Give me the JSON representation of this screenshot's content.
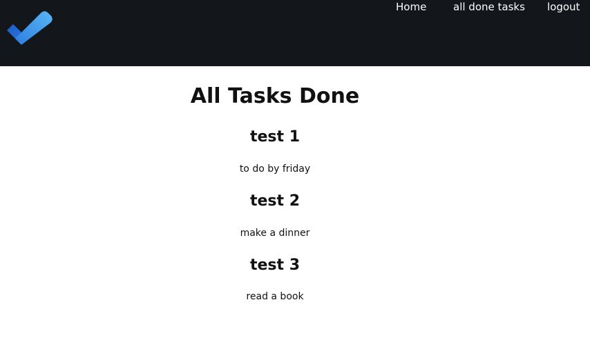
{
  "navbar": {
    "logo_icon": "checkmark-logo-icon",
    "accent_colors": [
      "#1f5fcf",
      "#4aa8f0"
    ],
    "background": "#13171b",
    "links": [
      {
        "label": "Home"
      },
      {
        "label": "all done tasks"
      },
      {
        "label": "logout"
      }
    ]
  },
  "main": {
    "title": "All Tasks Done",
    "tasks": [
      {
        "title": "test 1",
        "description": "to do by friday"
      },
      {
        "title": "test 2",
        "description": "make a dinner"
      },
      {
        "title": "test 3",
        "description": "read a book"
      }
    ]
  }
}
